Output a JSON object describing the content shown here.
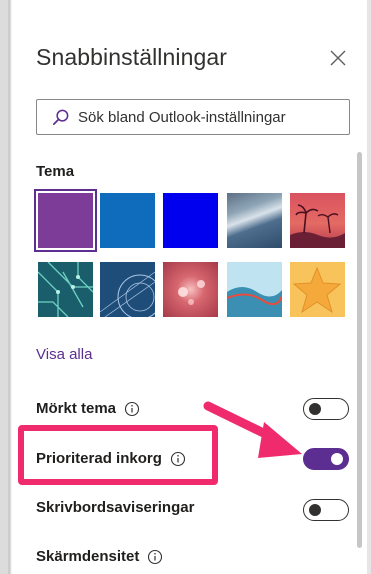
{
  "panel": {
    "title": "Snabbinställningar",
    "close_icon": "close-icon"
  },
  "search": {
    "placeholder": "Sök bland Outlook-inställningar",
    "icon": "search-icon"
  },
  "theme_section": {
    "title": "Tema",
    "selected_theme": "purple",
    "themes": [
      {
        "name": "purple",
        "color": "#7d3c98"
      },
      {
        "name": "blue",
        "color": "#0f6cbd"
      },
      {
        "name": "bright-blue",
        "color": "#0000ee"
      },
      {
        "name": "mountain",
        "color": "#3f5f7f"
      },
      {
        "name": "palm-sunset",
        "color": "#c4505f"
      },
      {
        "name": "circuit",
        "color": "#1b5e6b"
      },
      {
        "name": "blueprint",
        "color": "#1f4d7a"
      },
      {
        "name": "bokeh",
        "color": "#c24a52"
      },
      {
        "name": "wave",
        "color": "#5fa7c7"
      },
      {
        "name": "star",
        "color": "#f2b13c"
      }
    ],
    "see_all_link": "Visa alla"
  },
  "settings": [
    {
      "label": "Mörkt tema",
      "has_info": true,
      "toggle": false
    },
    {
      "label": "Prioriterad inkorg",
      "has_info": true,
      "toggle": true
    },
    {
      "label": "Skrivbordsaviseringar",
      "has_info": false,
      "toggle": false
    },
    {
      "label": "Skärmdensitet",
      "has_info": true
    }
  ],
  "annotation": {
    "color": "#ef2b6e",
    "highlighted_setting": "Prioriterad inkorg"
  },
  "colors": {
    "accent": "#5c2e91",
    "annotation": "#ef2b6e"
  }
}
